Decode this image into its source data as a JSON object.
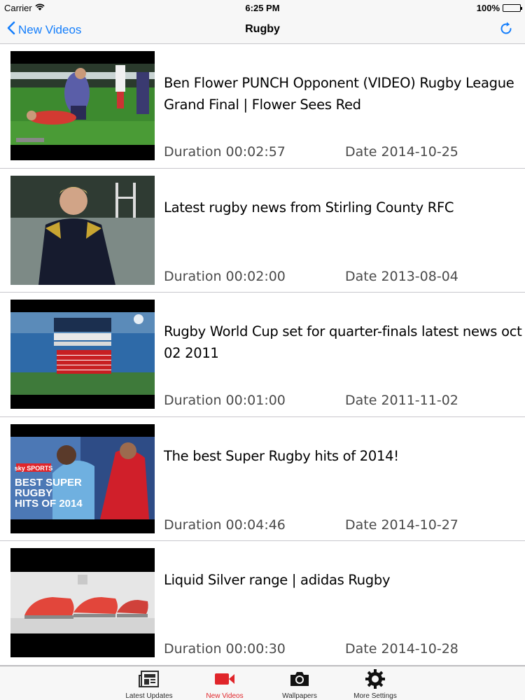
{
  "status_bar": {
    "carrier": "Carrier",
    "time": "6:25 PM",
    "battery": "100%"
  },
  "nav": {
    "back_label": "New Videos",
    "title": "Rugby"
  },
  "videos": [
    {
      "title": "Ben Flower PUNCH Opponent (VIDEO) Rugby League Grand Final | Flower Sees Red",
      "duration": "Duration 00:02:57",
      "date": "Date 2014-10-25"
    },
    {
      "title": "Latest rugby news from Stirling County RFC",
      "duration": "Duration 00:02:00",
      "date": "Date 2013-08-04"
    },
    {
      "title": "Rugby World Cup set for quarter-finals  latest news oct 02 2011",
      "duration": "Duration 00:01:00",
      "date": "Date 2011-11-02"
    },
    {
      "title": "The best Super Rugby hits of 2014!",
      "duration": "Duration 00:04:46",
      "date": "Date 2014-10-27",
      "thumb_text": [
        "sky SPORTS",
        "BEST SUPER",
        "RUGBY",
        "HITS OF 2014"
      ]
    },
    {
      "title": "Liquid Silver range | adidas Rugby",
      "duration": "Duration 00:00:30",
      "date": "Date 2014-10-28"
    }
  ],
  "tabs": [
    {
      "label": "Latest Updates",
      "icon": "newspaper-icon"
    },
    {
      "label": "New Videos",
      "icon": "video-camera-icon"
    },
    {
      "label": "Wallpapers",
      "icon": "camera-icon"
    },
    {
      "label": "More Settings",
      "icon": "gear-icon"
    }
  ],
  "colors": {
    "accent": "#147efb",
    "active_tab": "#e0252a",
    "separator": "#c8c7cc"
  }
}
